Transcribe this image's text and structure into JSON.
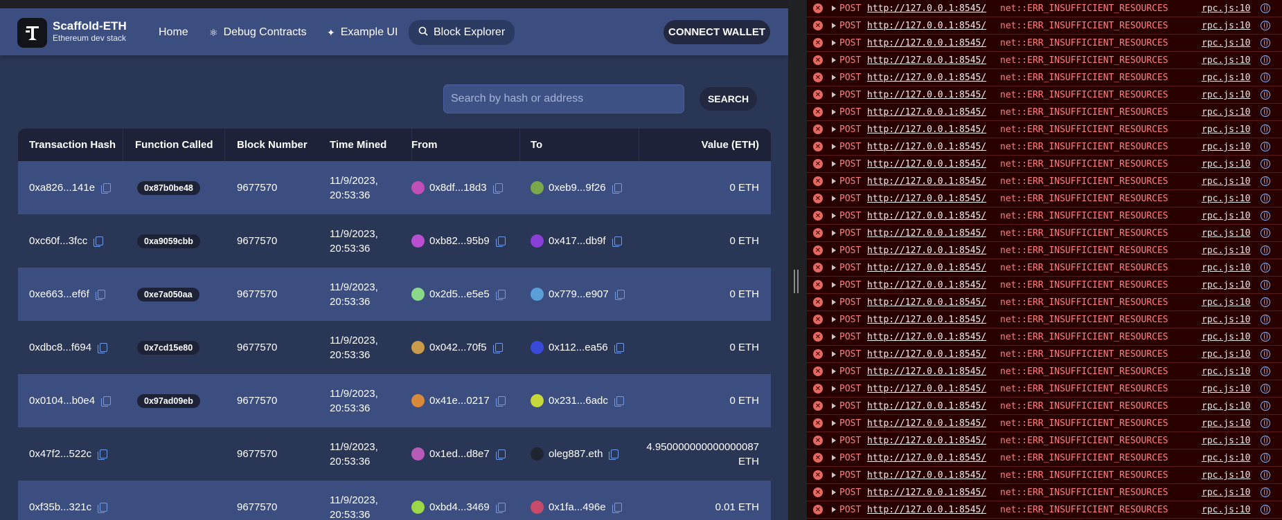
{
  "brand": {
    "title": "Scaffold-ETH",
    "subtitle": "Ethereum dev stack"
  },
  "nav": {
    "home": "Home",
    "debug": "Debug Contracts",
    "example": "Example UI",
    "explorer": "Block Explorer",
    "connect": "CONNECT WALLET"
  },
  "search": {
    "placeholder": "Search by hash or address",
    "button": "SEARCH"
  },
  "columns": [
    "Transaction Hash",
    "Function Called",
    "Block Number",
    "Time Mined",
    "From",
    "To",
    "Value (ETH)"
  ],
  "rows": [
    {
      "hash": "0xa826...141e",
      "fn": "0x87b0be48",
      "block": "9677570",
      "date": "11/9/2023,",
      "time": "20:53:36",
      "from": "0x8df...18d3",
      "to": "0xeb9...9f26",
      "value": "0 ETH",
      "value2": "",
      "fromColor": "#c24fb8",
      "toColor": "#7aa84a"
    },
    {
      "hash": "0xc60f...3fcc",
      "fn": "0xa9059cbb",
      "block": "9677570",
      "date": "11/9/2023,",
      "time": "20:53:36",
      "from": "0xb82...95b9",
      "to": "0x417...db9f",
      "value": "0 ETH",
      "value2": "",
      "fromColor": "#b84fd0",
      "toColor": "#8a3fd8"
    },
    {
      "hash": "0xe663...ef6f",
      "fn": "0xe7a050aa",
      "block": "9677570",
      "date": "11/9/2023,",
      "time": "20:53:36",
      "from": "0x2d5...e5e5",
      "to": "0x779...e907",
      "value": "0 ETH",
      "value2": "",
      "fromColor": "#8ad88a",
      "toColor": "#5aa0d8"
    },
    {
      "hash": "0xdbc8...f694",
      "fn": "0x7cd15e80",
      "block": "9677570",
      "date": "11/9/2023,",
      "time": "20:53:36",
      "from": "0x042...70f5",
      "to": "0x112...ea56",
      "value": "0 ETH",
      "value2": "",
      "fromColor": "#c89a4a",
      "toColor": "#3a4ad8"
    },
    {
      "hash": "0x0104...b0e4",
      "fn": "0x97ad09eb",
      "block": "9677570",
      "date": "11/9/2023,",
      "time": "20:53:36",
      "from": "0x41e...0217",
      "to": "0x231...6adc",
      "value": "0 ETH",
      "value2": "",
      "fromColor": "#d88a3a",
      "toColor": "#c8d83a"
    },
    {
      "hash": "0x47f2...522c",
      "fn": "",
      "block": "9677570",
      "date": "11/9/2023,",
      "time": "20:53:36",
      "from": "0x1ed...d8e7",
      "to": "oleg887.eth",
      "value": "4.950000000000000087",
      "value2": "ETH",
      "fromColor": "#b85ab8",
      "toColor": "#202430"
    },
    {
      "hash": "0xf35b...321c",
      "fn": "",
      "block": "9677570",
      "date": "11/9/2023,",
      "time": "20:53:36",
      "from": "0xbd4...3469",
      "to": "0x1fa...496e",
      "value": "0.01 ETH",
      "value2": "",
      "fromColor": "#9ad84a",
      "toColor": "#c84a6a"
    }
  ],
  "console": {
    "method": "POST",
    "url": "http://127.0.0.1:8545/",
    "message": "net::ERR_INSUFFICIENT_RESOURCES",
    "source": "rpc.js:10",
    "count": 30
  }
}
